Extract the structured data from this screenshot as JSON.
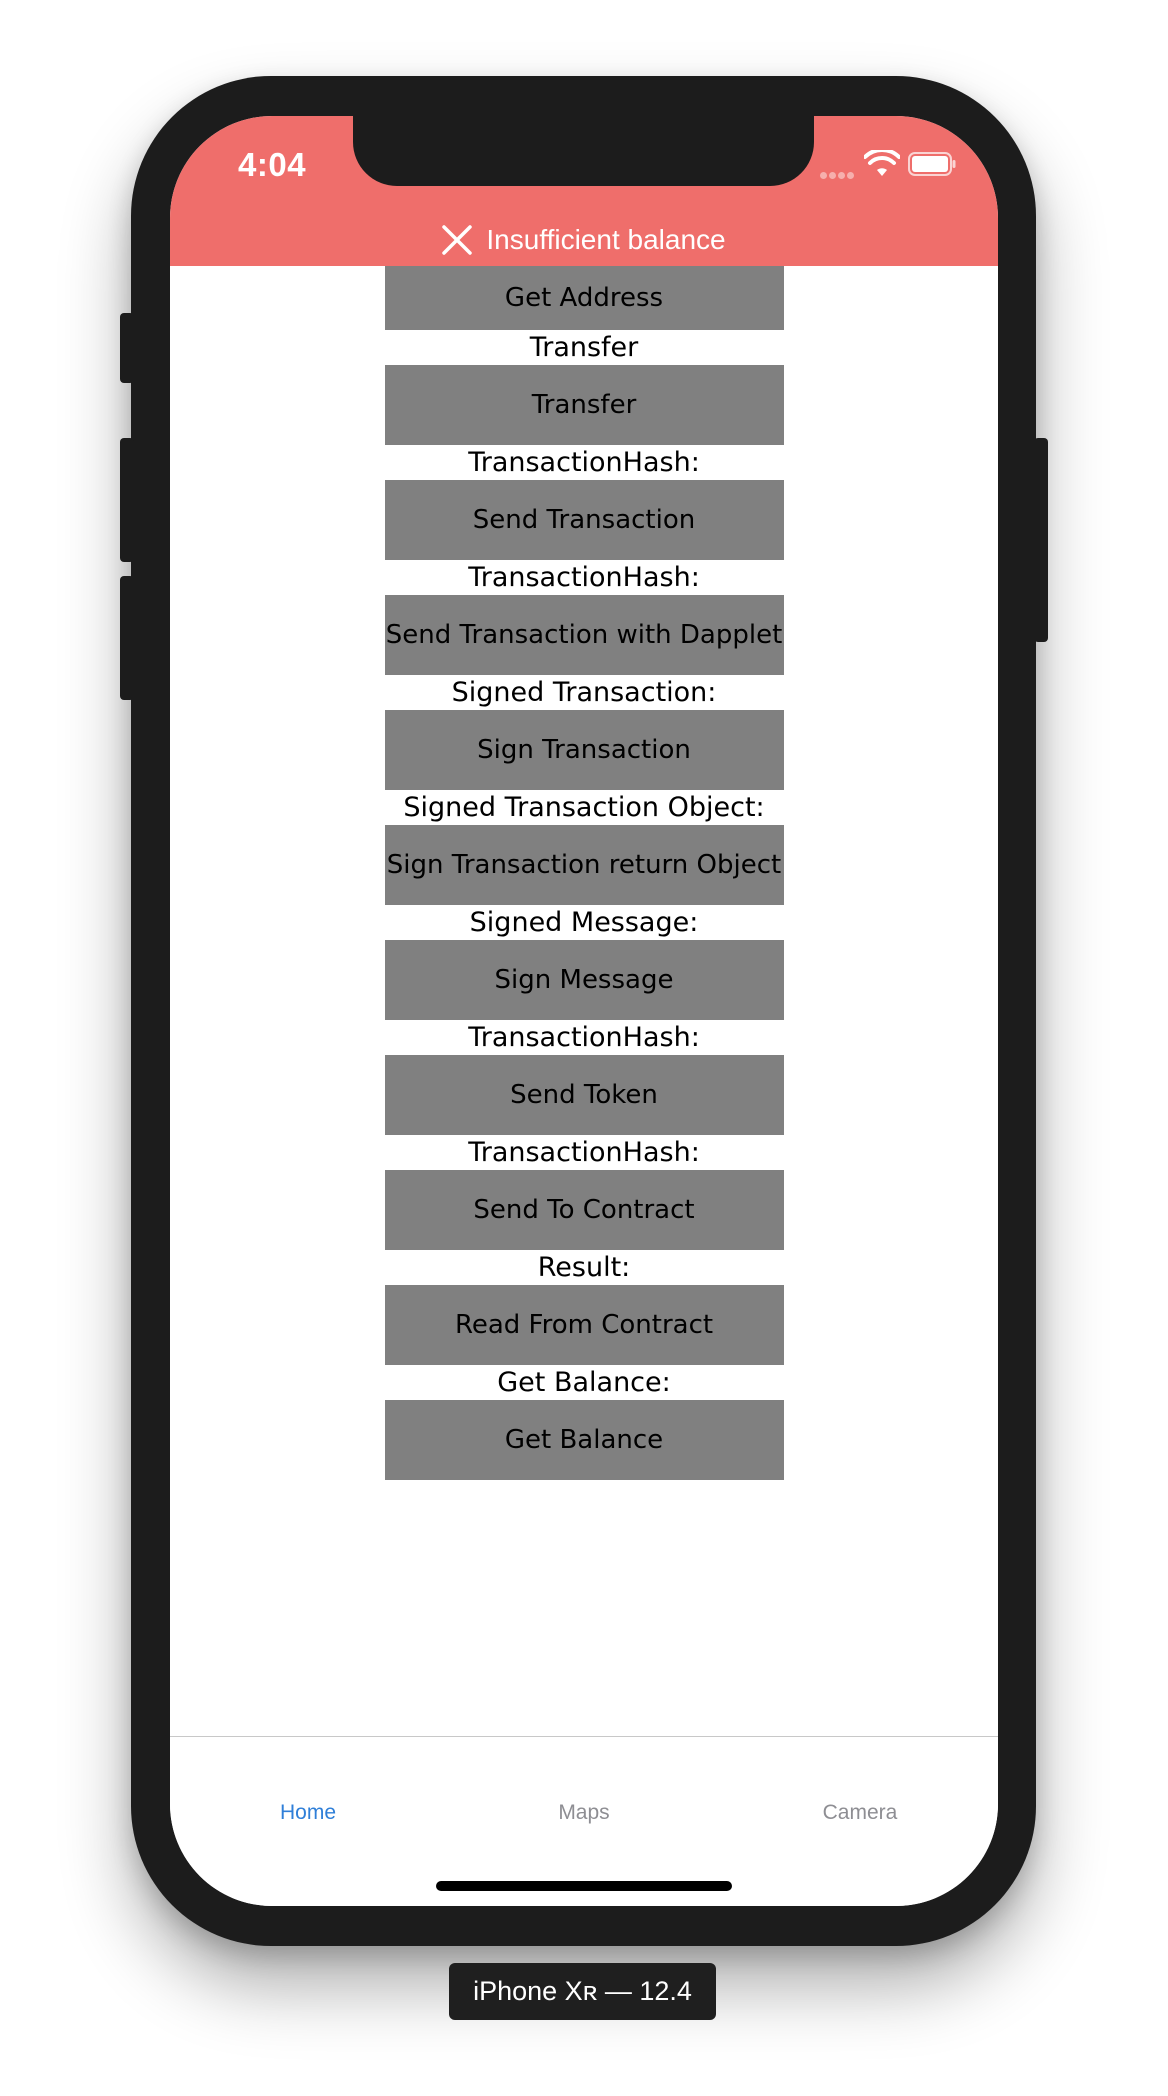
{
  "status_bar": {
    "time": "4:04"
  },
  "banner": {
    "message": "Insufficient balance"
  },
  "content": {
    "top_button": "Get Address",
    "rows": [
      {
        "label": "Transfer",
        "button": "Transfer"
      },
      {
        "label": "TransactionHash:",
        "button": "Send Transaction"
      },
      {
        "label": "TransactionHash:",
        "button": "Send Transaction with Dapplet"
      },
      {
        "label": "Signed Transaction:",
        "button": "Sign Transaction"
      },
      {
        "label": "Signed Transaction Object:",
        "button": "Sign Transaction return Object"
      },
      {
        "label": "Signed Message:",
        "button": "Sign Message"
      },
      {
        "label": "TransactionHash:",
        "button": "Send Token"
      },
      {
        "label": "TransactionHash:",
        "button": "Send To Contract"
      },
      {
        "label": "Result:",
        "button": "Read From Contract"
      },
      {
        "label": "Get Balance:",
        "button": "Get Balance"
      }
    ]
  },
  "tab_bar": {
    "tabs": [
      {
        "label": "Home",
        "active": true
      },
      {
        "label": "Maps",
        "active": false
      },
      {
        "label": "Camera",
        "active": false
      }
    ]
  },
  "device_label": "iPhone Xʀ — 12.4",
  "colors": {
    "banner": "#ef6e6b",
    "button": "#808080",
    "tab_active": "#2f7fd8",
    "tab_inactive": "#8e8e93"
  }
}
